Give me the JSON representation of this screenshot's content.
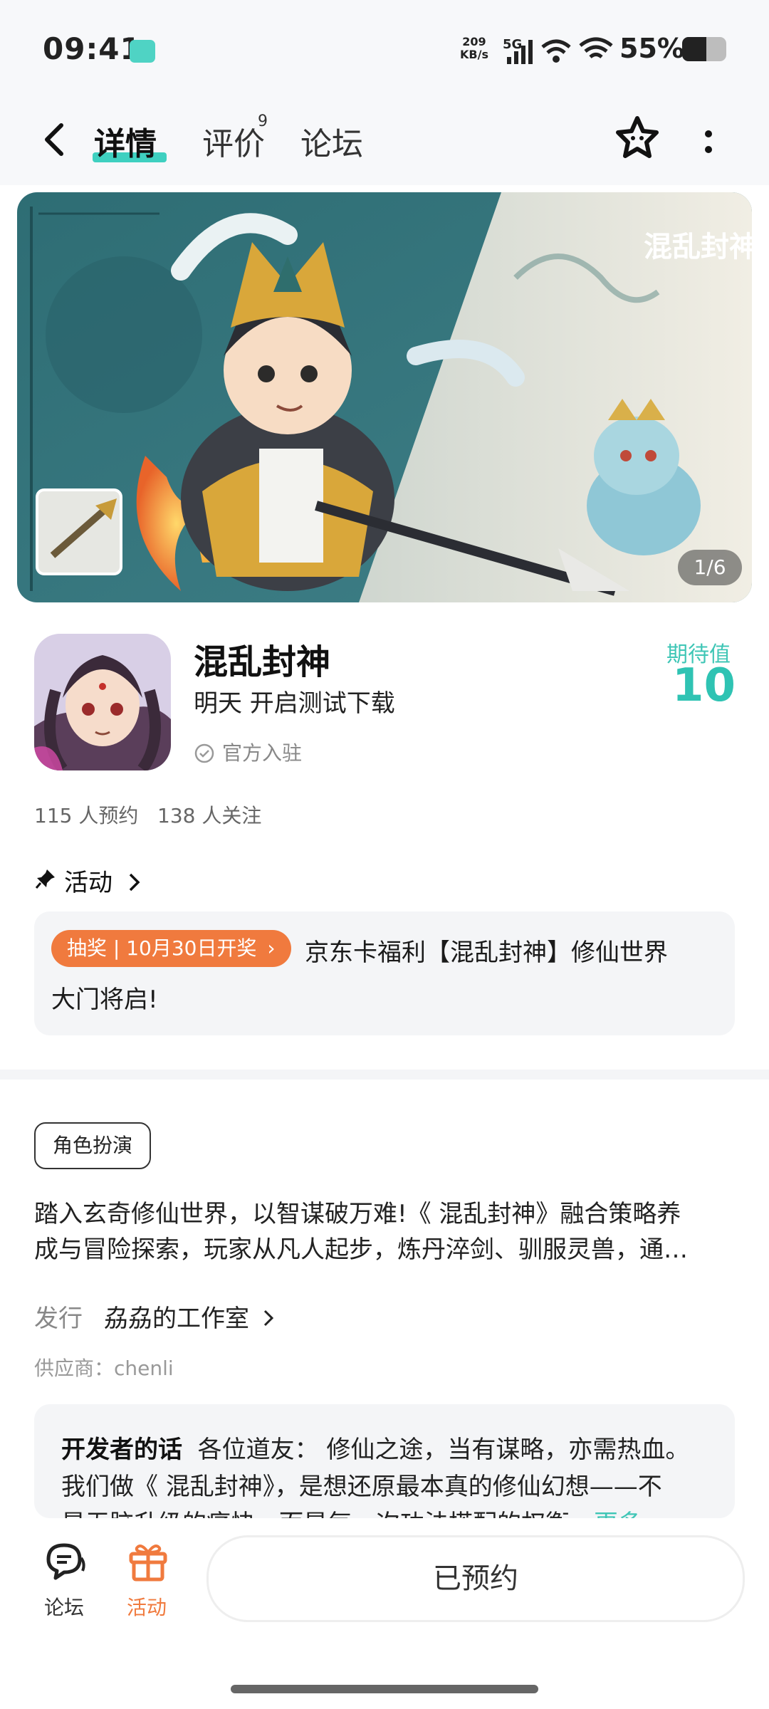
{
  "status_bar": {
    "time": "09:41",
    "net_speed_value": "209",
    "net_speed_unit": "KB/s",
    "network": "5G",
    "battery_percent": "55%",
    "battery_level": 0.55
  },
  "nav": {
    "tabs": [
      {
        "label": "详情",
        "active": true
      },
      {
        "label": "评价",
        "badge": "9"
      },
      {
        "label": "论坛"
      }
    ]
  },
  "banner": {
    "counter": "1/6",
    "logo_text": "混乱封神"
  },
  "game": {
    "title": "混乱封神",
    "subtitle": "明天 开启测试下载",
    "official_label": "官方入驻",
    "expectation_label": "期待值",
    "expectation_value": "10",
    "stats": "115 人预约   138 人关注"
  },
  "activity": {
    "section_label": "活动",
    "tag": "抽奖 | 10月30日开奖",
    "title_line1": "京东卡福利【混乱封神】修仙世界",
    "title_line2": "大门将启!"
  },
  "details": {
    "genre": "角色扮演",
    "desc_line1": "踏入玄奇修仙世界，以智谋破万难!《 混乱封神》融合策略养",
    "desc_line2": "成与冒险探索，玩家从凡人起步，炼丹淬剑、驯服灵兽，通…",
    "publisher_label": "发行",
    "publisher_name": "劦劦的工作室",
    "supplier": "供应商：chenli"
  },
  "developer_note": {
    "label": "开发者的话",
    "line1": "各位道友：  修仙之途，当有谋略，亦需热血。",
    "line2": "我们做《 混乱封神》，是想还原最本真的修仙幻想——不",
    "line3": "是无脑升级的痛快，而是每一次功法搭配的权衡，",
    "more": "更多"
  },
  "bottom_bar": {
    "forum_label": "论坛",
    "activity_label": "活动",
    "reserve_label": "已预约",
    "accent": "#f07a3e"
  }
}
